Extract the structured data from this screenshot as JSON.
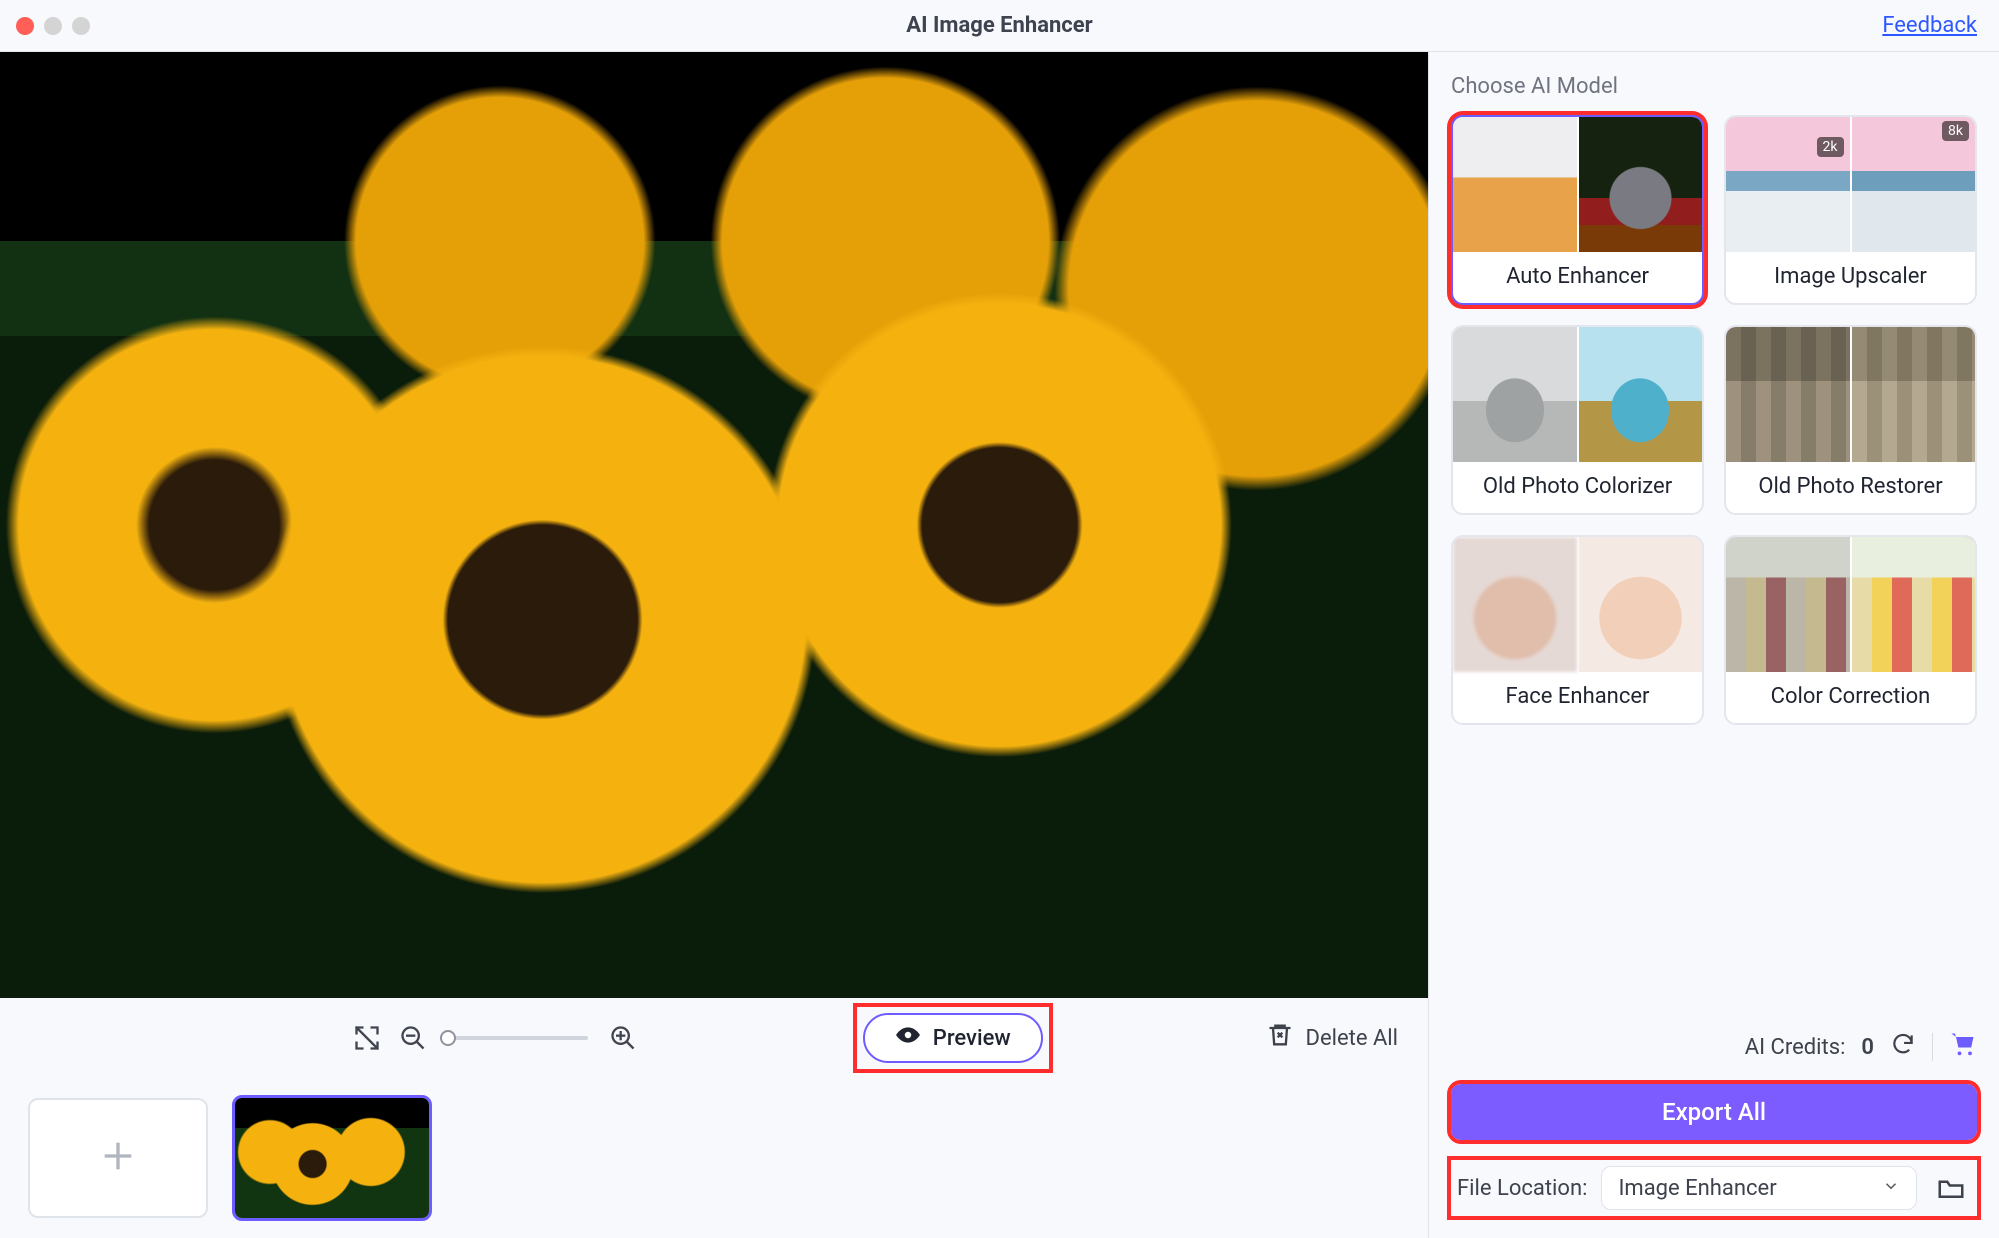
{
  "titlebar": {
    "title": "AI Image Enhancer",
    "feedback": "Feedback"
  },
  "toolbar": {
    "preview_label": "Preview",
    "delete_all_label": "Delete All"
  },
  "models": {
    "section_label": "Choose AI Model",
    "cards": [
      {
        "key": "auto-enhancer",
        "label": "Auto Enhancer",
        "selected": true
      },
      {
        "key": "image-upscaler",
        "label": "Image Upscaler",
        "selected": false,
        "badge_left": "2k",
        "badge_right": "8k"
      },
      {
        "key": "old-photo-colorizer",
        "label": "Old Photo Colorizer",
        "selected": false
      },
      {
        "key": "old-photo-restorer",
        "label": "Old Photo Restorer",
        "selected": false
      },
      {
        "key": "face-enhancer",
        "label": "Face Enhancer",
        "selected": false
      },
      {
        "key": "color-correction",
        "label": "Color Correction",
        "selected": false
      }
    ]
  },
  "credits": {
    "label": "AI Credits:",
    "value": "0"
  },
  "export": {
    "button_label": "Export All"
  },
  "file_location": {
    "label": "File Location:",
    "selected": "Image Enhancer"
  }
}
